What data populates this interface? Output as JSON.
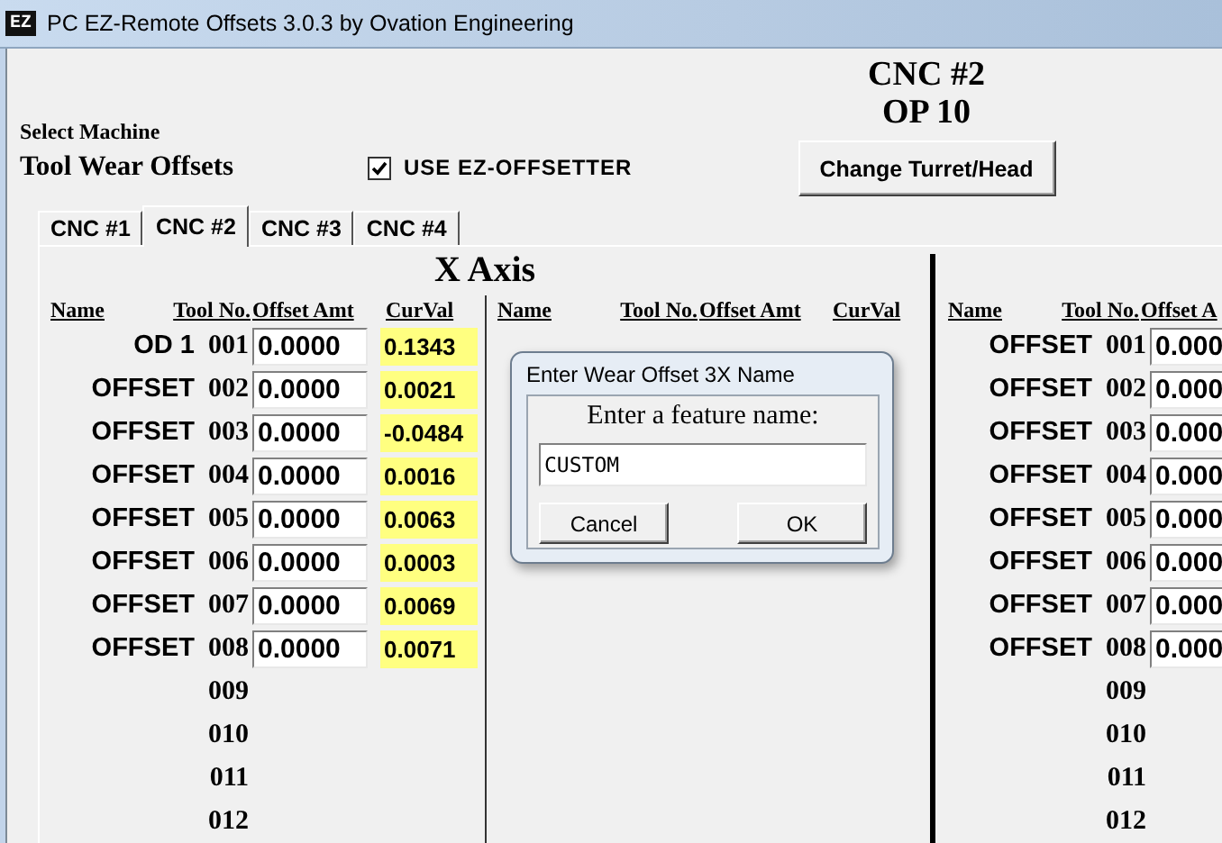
{
  "window": {
    "icon_text": "EZ",
    "title": "PC EZ-Remote Offsets 3.0.3 by Ovation Engineering"
  },
  "header": {
    "select_label": "Select Machine",
    "section_title": "Tool Wear Offsets",
    "use_ez_offsetter": {
      "label": "USE EZ-OFFSETTER",
      "checked": true
    },
    "machine": "CNC #2",
    "operation": "OP 10",
    "change_button": "Change Turret/Head"
  },
  "tabs": [
    {
      "label": "CNC #1",
      "selected": false
    },
    {
      "label": "CNC #2",
      "selected": true
    },
    {
      "label": "CNC #3",
      "selected": false
    },
    {
      "label": "CNC #4",
      "selected": false
    }
  ],
  "axis_title": "X Axis",
  "sections": [
    {
      "columns": [
        "Name",
        "Tool No.",
        "Offset Amt",
        "CurVal"
      ],
      "rows": [
        {
          "name": "OD 1",
          "tool_no": "001",
          "offset_amt": "0.0000",
          "curval": "0.1343"
        },
        {
          "name": "OFFSET",
          "tool_no": "002",
          "offset_amt": "0.0000",
          "curval": "0.0021"
        },
        {
          "name": "OFFSET",
          "tool_no": "003",
          "offset_amt": "0.0000",
          "curval": "-0.0484"
        },
        {
          "name": "OFFSET",
          "tool_no": "004",
          "offset_amt": "0.0000",
          "curval": "0.0016"
        },
        {
          "name": "OFFSET",
          "tool_no": "005",
          "offset_amt": "0.0000",
          "curval": "0.0063"
        },
        {
          "name": "OFFSET",
          "tool_no": "006",
          "offset_amt": "0.0000",
          "curval": "0.0003"
        },
        {
          "name": "OFFSET",
          "tool_no": "007",
          "offset_amt": "0.0000",
          "curval": "0.0069"
        },
        {
          "name": "OFFSET",
          "tool_no": "008",
          "offset_amt": "0.0000",
          "curval": "0.0071"
        },
        {
          "tool_no": "009"
        },
        {
          "tool_no": "010"
        },
        {
          "tool_no": "011"
        },
        {
          "tool_no": "012"
        }
      ]
    },
    {
      "columns": [
        "Name",
        "Tool No.",
        "Offset Amt",
        "CurVal"
      ]
    },
    {
      "columns": [
        "Name",
        "Tool No.",
        "Offset A"
      ],
      "rows": [
        {
          "name": "OFFSET",
          "tool_no": "001",
          "offset_amt": "0.000"
        },
        {
          "name": "OFFSET",
          "tool_no": "002",
          "offset_amt": "0.000"
        },
        {
          "name": "OFFSET",
          "tool_no": "003",
          "offset_amt": "0.000"
        },
        {
          "name": "OFFSET",
          "tool_no": "004",
          "offset_amt": "0.000"
        },
        {
          "name": "OFFSET",
          "tool_no": "005",
          "offset_amt": "0.000"
        },
        {
          "name": "OFFSET",
          "tool_no": "006",
          "offset_amt": "0.000"
        },
        {
          "name": "OFFSET",
          "tool_no": "007",
          "offset_amt": "0.000"
        },
        {
          "name": "OFFSET",
          "tool_no": "008",
          "offset_amt": "0.000"
        },
        {
          "tool_no": "009"
        },
        {
          "tool_no": "010"
        },
        {
          "tool_no": "011"
        },
        {
          "tool_no": "012"
        }
      ]
    }
  ],
  "dialog": {
    "title": "Enter Wear Offset 3X Name",
    "prompt": "Enter a feature name:",
    "value": "CUSTOM",
    "buttons": [
      "Cancel",
      "OK"
    ]
  }
}
